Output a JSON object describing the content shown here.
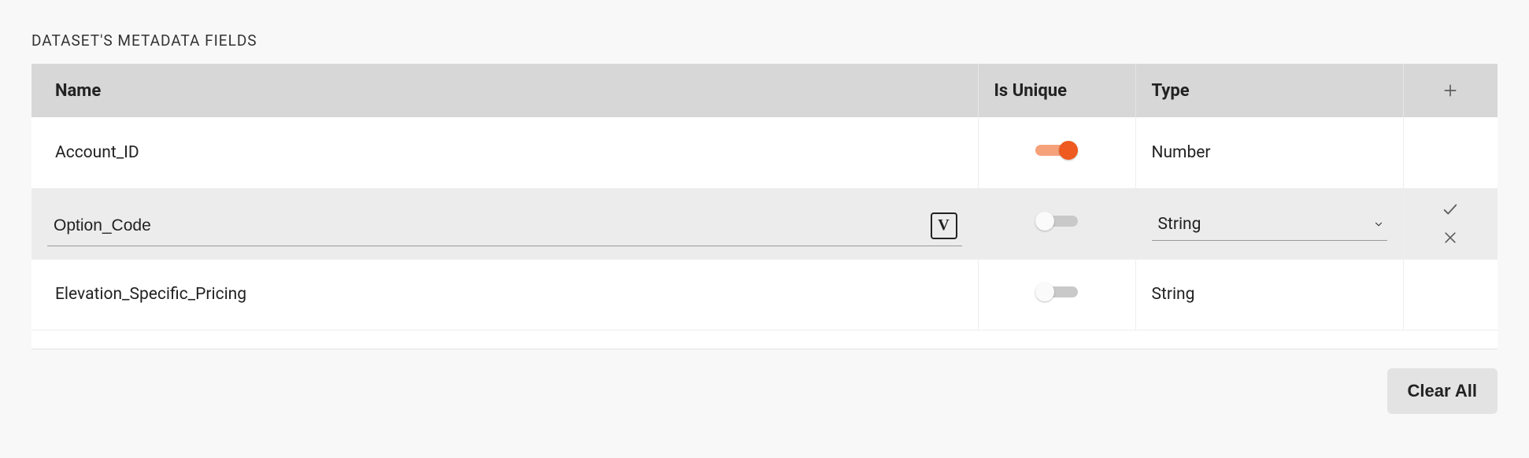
{
  "section_title": "DATASET'S METADATA FIELDS",
  "columns": {
    "name": "Name",
    "is_unique": "Is Unique",
    "type": "Type"
  },
  "rows": [
    {
      "name": "Account_ID",
      "is_unique": true,
      "type": "Number",
      "editing": false
    },
    {
      "name": "Option_Code",
      "is_unique": false,
      "type": "String",
      "editing": true
    },
    {
      "name": "Elevation_Specific_Pricing",
      "is_unique": false,
      "type": "String",
      "editing": false
    }
  ],
  "vim_badge_glyph": "V",
  "buttons": {
    "clear_all": "Clear All"
  }
}
